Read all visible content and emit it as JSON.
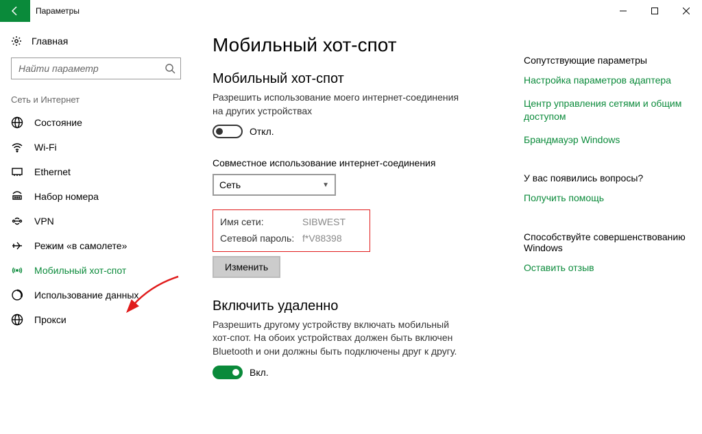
{
  "window": {
    "title": "Параметры"
  },
  "sidebar": {
    "home": "Главная",
    "search_placeholder": "Найти параметр",
    "section": "Сеть и Интернет",
    "items": [
      {
        "label": "Состояние"
      },
      {
        "label": "Wi-Fi"
      },
      {
        "label": "Ethernet"
      },
      {
        "label": "Набор номера"
      },
      {
        "label": "VPN"
      },
      {
        "label": "Режим «в самолете»"
      },
      {
        "label": "Мобильный хот-спот"
      },
      {
        "label": "Использование данных"
      },
      {
        "label": "Прокси"
      }
    ]
  },
  "main": {
    "title": "Мобильный хот-спот",
    "hotspot": {
      "heading": "Мобильный хот-спот",
      "desc": "Разрешить использование моего интернет-соединения на других устройствах",
      "state": "Откл."
    },
    "share": {
      "heading": "Совместное использование интернет-соединения",
      "select": "Сеть"
    },
    "network": {
      "name_label": "Имя сети:",
      "name_value": "SIBWEST",
      "pass_label": "Сетевой пароль:",
      "pass_value": "f*V88398",
      "edit": "Изменить"
    },
    "remote": {
      "heading": "Включить удаленно",
      "desc": "Разрешить другому устройству включать мобильный хот-спот. На обоих устройствах должен быть включен Bluetooth и они должны быть подключены друг к другу.",
      "state": "Вкл."
    }
  },
  "right": {
    "related_heading": "Сопутствующие параметры",
    "links": [
      "Настройка параметров адаптера",
      "Центр управления сетями и общим доступом",
      "Брандмауэр Windows"
    ],
    "help_heading": "У вас появились вопросы?",
    "help_link": "Получить помощь",
    "feedback_heading": "Способствуйте совершенствованию Windows",
    "feedback_link": "Оставить отзыв"
  }
}
